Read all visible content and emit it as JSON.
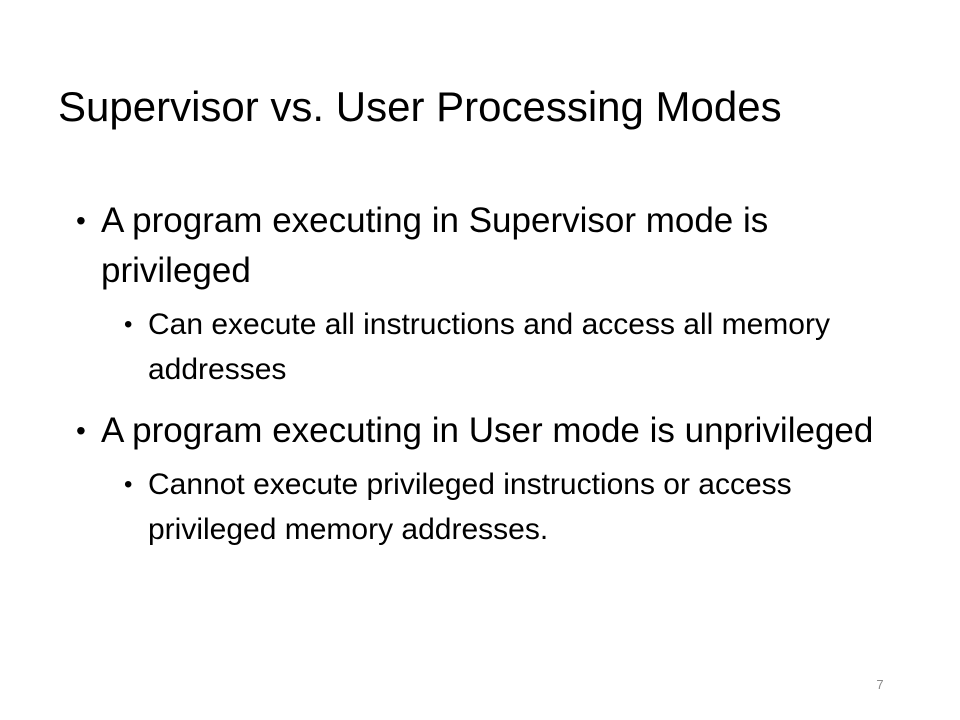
{
  "slide": {
    "title": "Supervisor vs. User Processing Modes",
    "bullet_glyph": "•",
    "bullets": [
      {
        "text": "A program executing in Supervisor mode is privileged",
        "sub": [
          {
            "text": "Can execute all instructions and access all memory addresses"
          }
        ]
      },
      {
        "text": "A program executing in User mode is unprivileged",
        "sub": [
          {
            "text": "Cannot execute privileged instructions or access privileged memory addresses."
          }
        ]
      }
    ],
    "page_number": "7"
  }
}
